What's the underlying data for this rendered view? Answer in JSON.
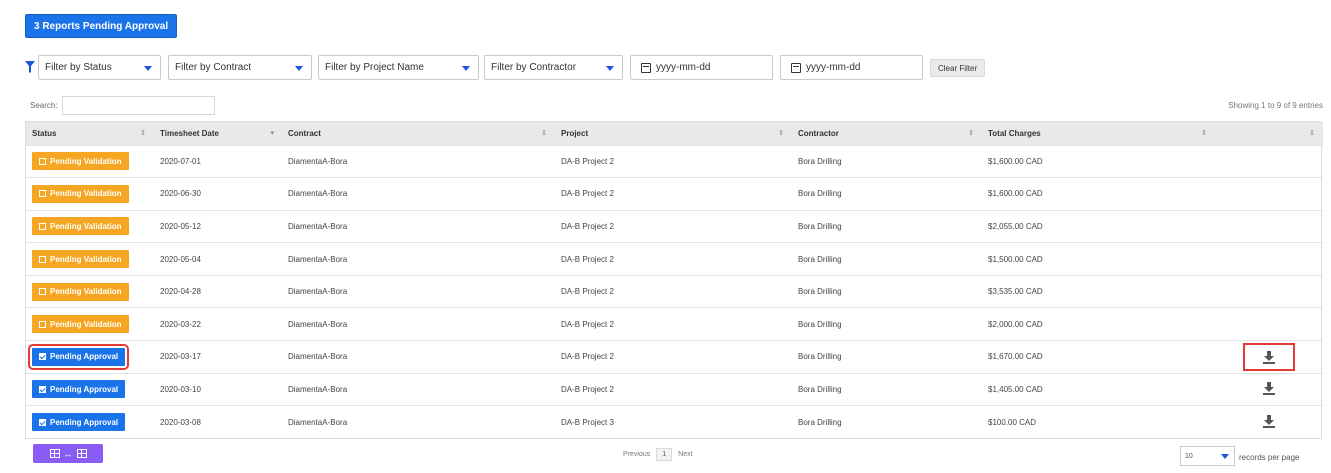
{
  "top_button": {
    "label": "3 Reports Pending Approval"
  },
  "filters": {
    "status": "Filter by Status",
    "contract": "Filter by Contract",
    "project": "Filter by Project Name",
    "contractor": "Filter by Contractor",
    "date_from": "yyyy-mm-dd",
    "date_to": "yyyy-mm-dd",
    "clear": "Clear Filter"
  },
  "search": {
    "label": "Search:",
    "value": ""
  },
  "showing_text": "Showing 1 to 9 of 9 entries",
  "table": {
    "headers": [
      "Status",
      "Timesheet Date",
      "Contract",
      "Project",
      "Contractor",
      "Total Charges",
      ""
    ],
    "rows": [
      {
        "status": "Pending Validation",
        "date": "2020-07-01",
        "contract": "DiamentaA-Bora",
        "project": "DA-B Project 2",
        "contractor": "Bora Drilling",
        "charges": "$1,600.00 CAD"
      },
      {
        "status": "Pending Validation",
        "date": "2020-06-30",
        "contract": "DiamentaA-Bora",
        "project": "DA-B Project 2",
        "contractor": "Bora Drilling",
        "charges": "$1,600.00 CAD"
      },
      {
        "status": "Pending Validation",
        "date": "2020-05-12",
        "contract": "DiamentaA-Bora",
        "project": "DA-B Project 2",
        "contractor": "Bora Drilling",
        "charges": "$2,055.00 CAD"
      },
      {
        "status": "Pending Validation",
        "date": "2020-05-04",
        "contract": "DiamentaA-Bora",
        "project": "DA-B Project 2",
        "contractor": "Bora Drilling",
        "charges": "$1,500.00 CAD"
      },
      {
        "status": "Pending Validation",
        "date": "2020-04-28",
        "contract": "DiamentaA-Bora",
        "project": "DA-B Project 2",
        "contractor": "Bora Drilling",
        "charges": "$3,535.00 CAD"
      },
      {
        "status": "Pending Validation",
        "date": "2020-03-22",
        "contract": "DiamentaA-Bora",
        "project": "DA-B Project 2",
        "contractor": "Bora Drilling",
        "charges": "$2,000.00 CAD"
      },
      {
        "status": "Pending Approval",
        "date": "2020-03-17",
        "contract": "DiamentaA-Bora",
        "project": "DA-B Project 2",
        "contractor": "Bora Drilling",
        "charges": "$1,670.00 CAD"
      },
      {
        "status": "Pending Approval",
        "date": "2020-03-10",
        "contract": "DiamentaA-Bora",
        "project": "DA-B Project 2",
        "contractor": "Bora Drilling",
        "charges": "$1,405.00 CAD"
      },
      {
        "status": "Pending Approval",
        "date": "2020-03-08",
        "contract": "DiamentaA-Bora",
        "project": "DA-B Project 3",
        "contractor": "Bora Drilling",
        "charges": "$100.00 CAD"
      }
    ]
  },
  "pagination": {
    "previous": "Previous",
    "page": "1",
    "next": "Next"
  },
  "records_per_page": {
    "value": "10",
    "label": "records per page"
  },
  "colors": {
    "primary": "#1a73e8",
    "pending_validation": "#f5a623",
    "highlight": "#e53935",
    "toggle": "#8a5cf6"
  }
}
